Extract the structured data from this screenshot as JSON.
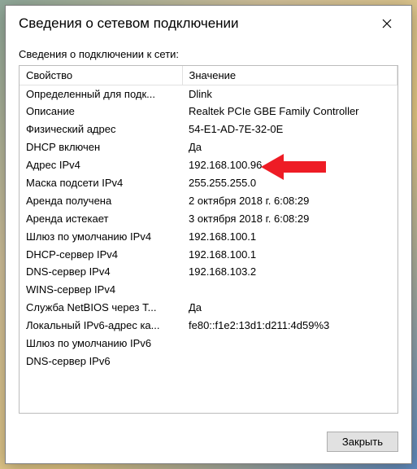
{
  "title": "Сведения о сетевом подключении",
  "subheader": "Сведения о подключении к сети:",
  "columns": {
    "property": "Свойство",
    "value": "Значение"
  },
  "rows": [
    {
      "property": "Определенный для подк...",
      "value": "Dlink"
    },
    {
      "property": "Описание",
      "value": "Realtek PCIe GBE Family Controller"
    },
    {
      "property": "Физический адрес",
      "value": "54-E1-AD-7E-32-0E"
    },
    {
      "property": "DHCP включен",
      "value": "Да"
    },
    {
      "property": "Адрес IPv4",
      "value": "192.168.100.96"
    },
    {
      "property": "Маска подсети IPv4",
      "value": "255.255.255.0"
    },
    {
      "property": "Аренда получена",
      "value": "2 октября 2018 г. 6:08:29"
    },
    {
      "property": "Аренда истекает",
      "value": "3 октября 2018 г. 6:08:29"
    },
    {
      "property": "Шлюз по умолчанию IPv4",
      "value": "192.168.100.1"
    },
    {
      "property": "DHCP-сервер IPv4",
      "value": "192.168.100.1"
    },
    {
      "property": "DNS-сервер IPv4",
      "value": "192.168.103.2"
    },
    {
      "property": "WINS-сервер IPv4",
      "value": ""
    },
    {
      "property": "Служба NetBIOS через T...",
      "value": "Да"
    },
    {
      "property": "Локальный IPv6-адрес ка...",
      "value": "fe80::f1e2:13d1:d211:4d59%3"
    },
    {
      "property": "Шлюз по умолчанию IPv6",
      "value": ""
    },
    {
      "property": "DNS-сервер IPv6",
      "value": ""
    }
  ],
  "highlight_row_index": 4,
  "close_button_label": "Закрыть"
}
